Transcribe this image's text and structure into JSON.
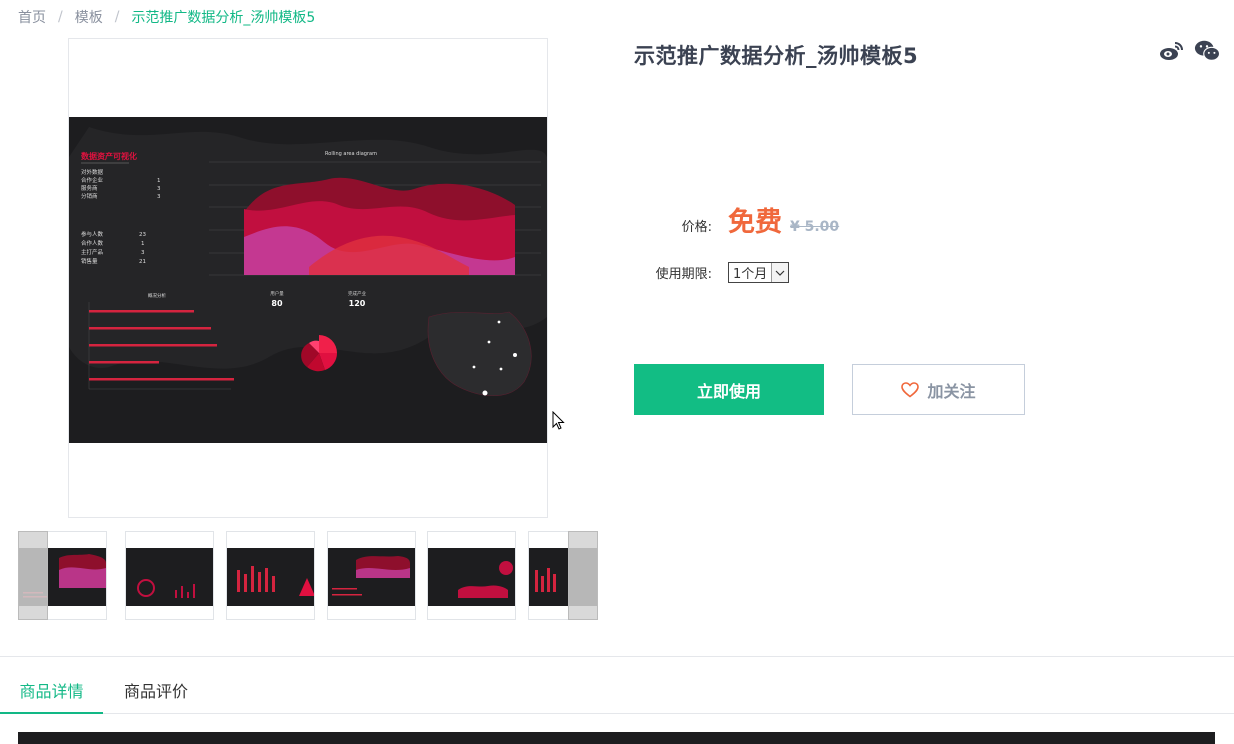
{
  "breadcrumb": {
    "home": "首页",
    "templates": "模板",
    "current": "示范推广数据分析_汤帅模板5",
    "separator": "/"
  },
  "product": {
    "title": "示范推广数据分析_汤帅模板5",
    "price_label": "价格:",
    "price_free": "免费",
    "price_original": "¥ 5.00",
    "period_label": "使用期限:",
    "period_value": "1个月",
    "use_button": "立即使用",
    "follow_button": "加关注"
  },
  "preview": {
    "top_left_title": "数据资产可视化",
    "stats_group1": [
      {
        "k": "对外数据",
        "v": ""
      },
      {
        "k": "合作企业",
        "v": "1"
      },
      {
        "k": "服务商",
        "v": "3"
      },
      {
        "k": "分销商",
        "v": "3"
      }
    ],
    "stats_group2": [
      {
        "k": "参与人数",
        "v": "23"
      },
      {
        "k": "合作人数",
        "v": "1"
      },
      {
        "k": "主打产品",
        "v": "3"
      },
      {
        "k": "销售量",
        "v": "21"
      }
    ],
    "area_title": "Rolling area diagram",
    "bar_title": "概况分析",
    "kpi1_label": "用户量",
    "kpi1_value": "80",
    "kpi2_label": "完成产业",
    "kpi2_value": "120"
  },
  "tabs": {
    "details": "商品详情",
    "reviews": "商品评价"
  },
  "colors": {
    "accent_green": "#12bd84",
    "price_orange": "#f0683c",
    "dashboard_bg": "#1d1d1f"
  }
}
